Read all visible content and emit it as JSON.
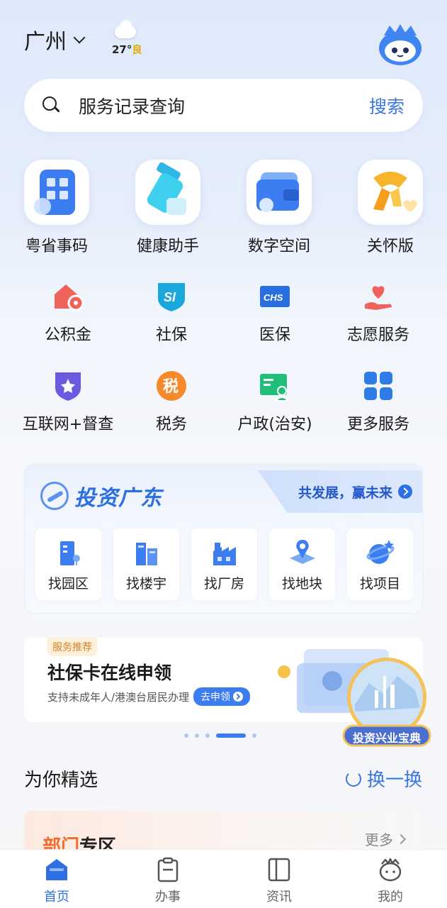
{
  "header": {
    "city": "广州",
    "weather": {
      "temp": "27°",
      "aqi": "良"
    }
  },
  "search": {
    "placeholder": "服务记录查询",
    "button": "搜索"
  },
  "main_apps": [
    {
      "label": "粤省事码",
      "icon": "qr-code-icon"
    },
    {
      "label": "健康助手",
      "icon": "health-assistant-icon"
    },
    {
      "label": "数字空间",
      "icon": "wallet-icon"
    },
    {
      "label": "关怀版",
      "icon": "scarf-heart-icon"
    }
  ],
  "services": [
    {
      "label": "公积金",
      "icon": "housing-fund-icon"
    },
    {
      "label": "社保",
      "icon": "social-security-icon"
    },
    {
      "label": "医保",
      "icon": "medical-insurance-icon"
    },
    {
      "label": "志愿服务",
      "icon": "volunteer-icon"
    },
    {
      "label": "互联网+督查",
      "icon": "inspection-shield-icon"
    },
    {
      "label": "税务",
      "icon": "tax-icon"
    },
    {
      "label": "户政(治安)",
      "icon": "household-registration-icon"
    },
    {
      "label": "更多服务",
      "icon": "more-services-icon"
    }
  ],
  "invest": {
    "title": "投资广东",
    "slogan": "共发展，赢未来",
    "items": [
      {
        "label": "找园区",
        "icon": "park-icon"
      },
      {
        "label": "找楼宇",
        "icon": "building-icon"
      },
      {
        "label": "找厂房",
        "icon": "factory-icon"
      },
      {
        "label": "找地块",
        "icon": "land-plot-icon"
      },
      {
        "label": "找项目",
        "icon": "project-icon"
      }
    ]
  },
  "banner": {
    "tag": "服务推荐",
    "title": "社保卡在线申领",
    "subtitle": "支持未成年人/港澳台居民办理",
    "cta": "去申领"
  },
  "medal": {
    "label": "投资兴业宝典"
  },
  "carousel": {
    "count": 5,
    "active_index": 3
  },
  "picks": {
    "title": "为你精选",
    "refresh": "换一换"
  },
  "dept": {
    "title_a": "部门",
    "title_b": "专区",
    "more": "更多"
  },
  "tabbar": [
    {
      "label": "首页",
      "icon": "home-icon",
      "active": true
    },
    {
      "label": "办事",
      "icon": "clipboard-icon",
      "active": false
    },
    {
      "label": "资讯",
      "icon": "news-icon",
      "active": false
    },
    {
      "label": "我的",
      "icon": "profile-icon",
      "active": false
    }
  ],
  "colors": {
    "accent": "#2f6fe6",
    "orange": "#f26b2a"
  }
}
